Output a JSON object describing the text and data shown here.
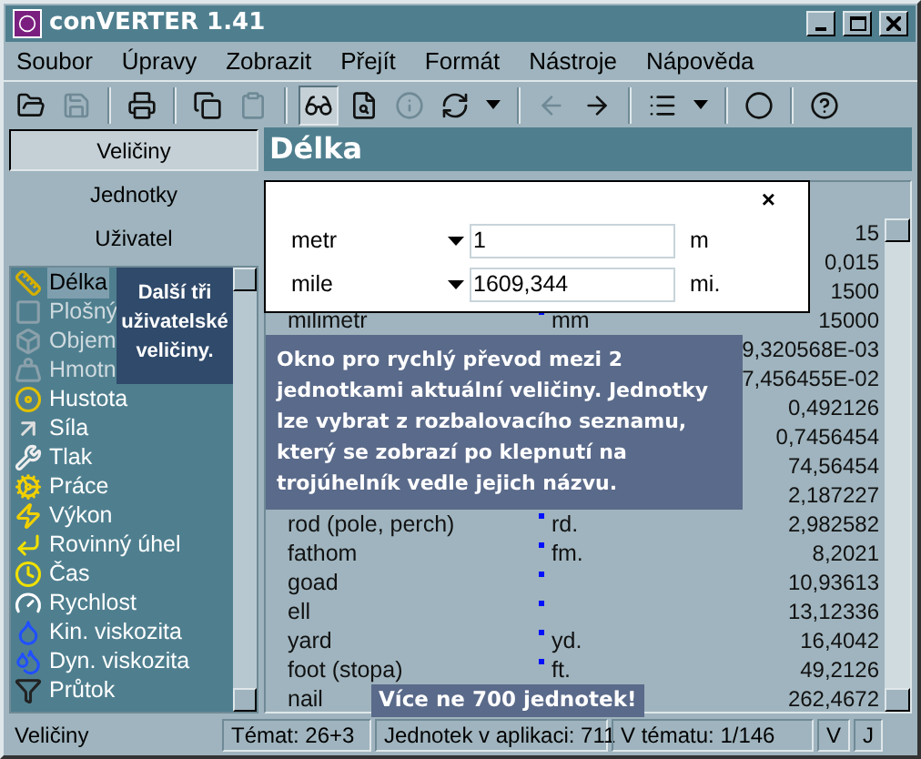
{
  "window": {
    "title": "conVERTER 1.41"
  },
  "menu": [
    "Soubor",
    "Úpravy",
    "Zobrazit",
    "Přejít",
    "Formát",
    "Nástroje",
    "Nápověda"
  ],
  "toolbar": [
    {
      "kind": "button",
      "disabled": false,
      "pressed": false
    },
    {
      "kind": "button",
      "disabled": true,
      "pressed": false
    },
    {
      "kind": "separator"
    },
    {
      "kind": "button",
      "disabled": false,
      "pressed": false
    },
    {
      "kind": "separator"
    },
    {
      "kind": "button",
      "disabled": false,
      "pressed": false
    },
    {
      "kind": "button",
      "disabled": true,
      "pressed": false
    },
    {
      "kind": "separator"
    },
    {
      "kind": "button",
      "disabled": false,
      "pressed": true
    },
    {
      "kind": "button",
      "disabled": false,
      "pressed": false
    },
    {
      "kind": "button",
      "disabled": true,
      "pressed": false
    },
    {
      "kind": "button",
      "disabled": false,
      "pressed": false
    },
    {
      "kind": "dropdown"
    },
    {
      "kind": "separator"
    },
    {
      "kind": "button",
      "disabled": true,
      "pressed": false
    },
    {
      "kind": "button",
      "disabled": false,
      "pressed": false
    },
    {
      "kind": "separator"
    },
    {
      "kind": "button",
      "disabled": false,
      "pressed": false
    },
    {
      "kind": "dropdown"
    },
    {
      "kind": "separator"
    },
    {
      "kind": "button",
      "disabled": false,
      "pressed": false
    },
    {
      "kind": "separator"
    },
    {
      "kind": "button",
      "disabled": false,
      "pressed": false
    }
  ],
  "side_tabs": [
    {
      "label": "Veličiny",
      "selected": true
    },
    {
      "label": "Jednotky",
      "selected": false
    },
    {
      "label": "Uživatel",
      "selected": false
    }
  ],
  "quantities": [
    {
      "label": "Délka",
      "selected": true,
      "disabled": false
    },
    {
      "label": "Plošný",
      "selected": false,
      "disabled": true
    },
    {
      "label": "Objem",
      "selected": false,
      "disabled": true
    },
    {
      "label": "Hmotn",
      "selected": false,
      "disabled": true
    },
    {
      "label": "Hustota",
      "selected": false,
      "disabled": false
    },
    {
      "label": "Síla",
      "selected": false,
      "disabled": false
    },
    {
      "label": "Tlak",
      "selected": false,
      "disabled": false
    },
    {
      "label": "Práce",
      "selected": false,
      "disabled": false
    },
    {
      "label": "Výkon",
      "selected": false,
      "disabled": false
    },
    {
      "label": "Rovinný úhel",
      "selected": false,
      "disabled": false
    },
    {
      "label": "Čas",
      "selected": false,
      "disabled": false
    },
    {
      "label": "Rychlost",
      "selected": false,
      "disabled": false
    },
    {
      "label": "Kin. viskozita",
      "selected": false,
      "disabled": false
    },
    {
      "label": "Dyn. viskozita",
      "selected": false,
      "disabled": false
    },
    {
      "label": "Průtok",
      "selected": false,
      "disabled": false
    }
  ],
  "sidebar_tip": "Další tři uživatelské veličiny.",
  "panel_title": "Délka",
  "quick_converter": {
    "close": "×",
    "rows": [
      {
        "unit": "metr",
        "value": "1",
        "abbr": "m"
      },
      {
        "unit": "mile",
        "value": "1609,344",
        "abbr": "mi."
      }
    ]
  },
  "table": {
    "rows": [
      {
        "value": "15"
      },
      {
        "value": "0,015"
      },
      {
        "value": "1500"
      },
      {
        "name": "milimetr",
        "abbr": "mm",
        "value": "15000"
      },
      {
        "value": "9,320568E-03"
      },
      {
        "value": "7,456455E-02"
      },
      {
        "value": "0,492126"
      },
      {
        "value": "0,7456454"
      },
      {
        "value": "74,56454"
      },
      {
        "value": "2,187227"
      },
      {
        "name": "rod (pole, perch)",
        "abbr": "rd.",
        "value": "2,982582"
      },
      {
        "name": "fathom",
        "abbr": "fm.",
        "value": "8,2021"
      },
      {
        "name": "goad",
        "value": "10,93613"
      },
      {
        "name": "ell",
        "value": "13,12336"
      },
      {
        "name": "yard",
        "abbr": "yd.",
        "value": "16,4042"
      },
      {
        "name": "foot (stopa)",
        "abbr": "ft.",
        "value": "49,2126"
      },
      {
        "name": "nail",
        "value": "262,4672"
      }
    ]
  },
  "converter_tip": "Okno pro rychlý převod mezi 2 jednotkami aktuální veličiny. Jednotky lze vybrat z rozbalovacího seznamu, který se zobrazí po klepnutí na trojúhelník vedle jejich názvu.",
  "units_tip": "Více ne 700 jednotek!",
  "status_bar": [
    "Veličiny",
    "Témat: 26+3",
    "Jednotek v aplikaci: 711",
    "V tématu: 1/146",
    "V",
    "J"
  ]
}
